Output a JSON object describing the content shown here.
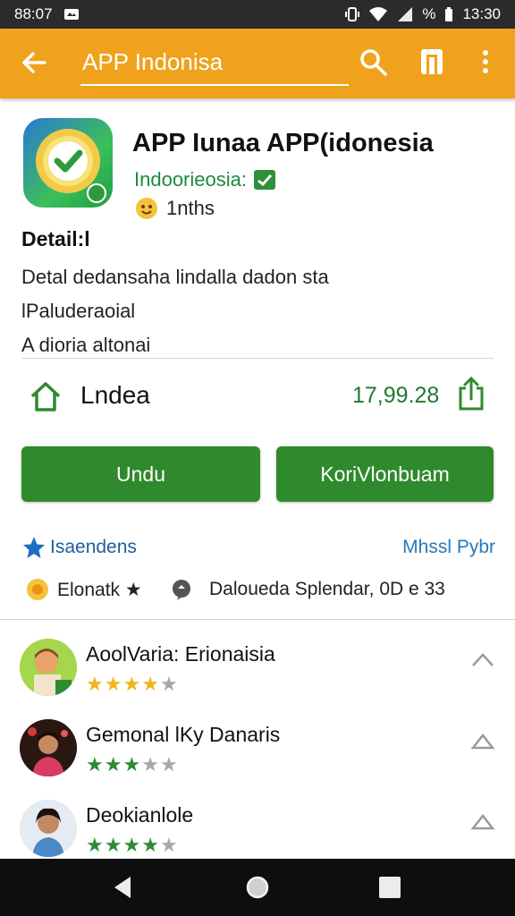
{
  "status_bar": {
    "left_time": "88:07",
    "right_percent": "%",
    "right_time": "13:30"
  },
  "app_bar": {
    "search_value": "APP Indonisa",
    "icons": [
      "back-arrow-icon",
      "search-icon",
      "bookmark-icon",
      "more-vert-icon"
    ],
    "background": "#f0a21c"
  },
  "app": {
    "title": "APP Iunaa APP(idonesia",
    "developer": "Indoorieosia:",
    "rating_text": "1nths"
  },
  "detail": {
    "title": "Detail:l",
    "lines": [
      "Detal dedansaha lindalla dadon sta",
      "lPaluderaoial",
      "A dioria altonai"
    ]
  },
  "install": {
    "label": "Lndea",
    "count": "17,99.28"
  },
  "buttons": {
    "primary": "Undu",
    "secondary": "KoriVlonbuam",
    "color": "#2f8a2e"
  },
  "reviews_header": {
    "label": "Isaendens",
    "link": "Mhssl Pybr"
  },
  "meta": {
    "text1": "Elonatk ★",
    "text2": "Daloueda  Splendar, 0D e  33"
  },
  "reviews": [
    {
      "name": "AoolVaria: Erionaisia",
      "rating": 4,
      "star_color": "gold"
    },
    {
      "name": "Gemonal lKy Danaris",
      "rating": 3,
      "star_color": "green"
    },
    {
      "name": "Deokianlole",
      "rating": 4,
      "star_color": "green"
    }
  ]
}
